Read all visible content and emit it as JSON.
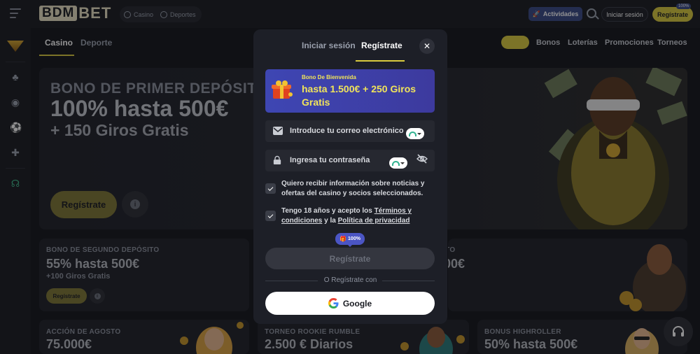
{
  "header": {
    "logo_left": "BDM",
    "logo_right": "BET",
    "switch_casino": "Casino",
    "switch_sports": "Deportes",
    "activities": "Actividades",
    "login": "Iniciar sesión",
    "register": "Regístrate",
    "register_badge": "100%"
  },
  "nav": {
    "tab_casino": "Casino",
    "tab_sport": "Deporte",
    "right_tabs": [
      "Bonos",
      "Loterías",
      "Promociones",
      "Torneos"
    ],
    "right_active": "Casino"
  },
  "hero": {
    "title": "BONO DE PRIMER DEPÓSITO",
    "amount": "100% hasta 500€",
    "sub": "+ 150 Giros Gratis",
    "button": "Regístrate",
    "info": "i"
  },
  "cards": [
    {
      "title": "BONO DE SEGUNDO DEPÓSITO",
      "amount": "55% hasta 500€",
      "sub": "+100 Giros Gratis",
      "button": "Regístrate"
    },
    {
      "title": "ÓSITO",
      "amount": "500€"
    },
    {
      "title": "ACCIÓN DE AGOSTO",
      "amount": "75.000€"
    },
    {
      "title": "TORNEO ROOKIE RUMBLE",
      "amount": "2.500 € Diarios"
    },
    {
      "title": "BONUS HIGHROLLER",
      "amount": "50% hasta 500€"
    }
  ],
  "modal": {
    "tab_login": "Iniciar sesión",
    "tab_register": "Regístrate",
    "close": "✕",
    "bonus_label": "Bono De Bienvenida",
    "bonus_text": "hasta 1.500€ + 250 Giros Gratis",
    "email_placeholder": "Introduce tu correo electrónico",
    "password_placeholder": "Ingresa tu contraseña",
    "consent1": "Quiero recibir información sobre noticias y ofertas del casino y socios seleccionados.",
    "consent2_prefix": "Tengo 18 años y acepto los ",
    "consent2_link1": "Términos y condiciones",
    "consent2_mid": " y la ",
    "consent2_link2": "Política de privacidad",
    "pct_badge": "100%",
    "submit": "Regístrate",
    "or_text": "O Regístrate con",
    "google": "Google"
  },
  "colors": {
    "accent": "#d9cb3e",
    "bonus_bg": "#3e46b3",
    "bonus_text": "#f1e45a"
  }
}
